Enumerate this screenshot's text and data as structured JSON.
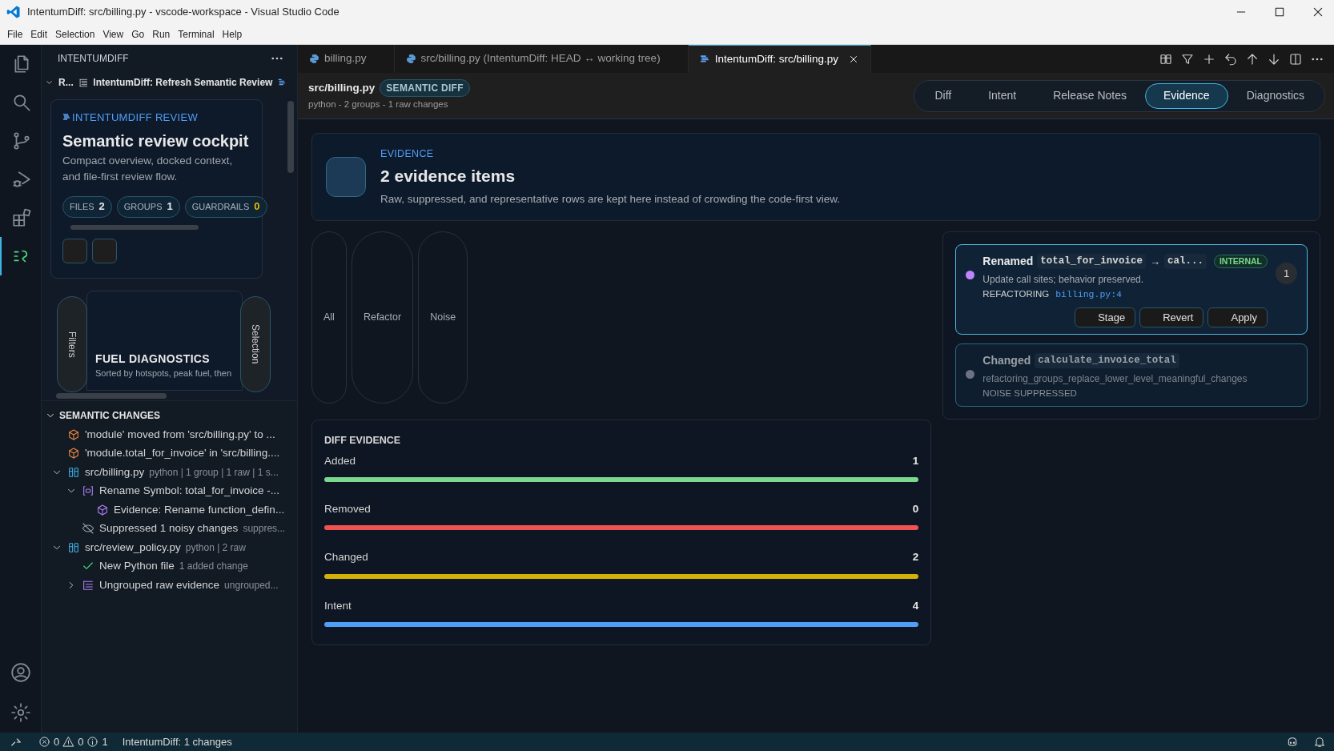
{
  "window": {
    "title": "IntentumDiff: src/billing.py - vscode-workspace - Visual Studio Code"
  },
  "menu": [
    "File",
    "Edit",
    "Selection",
    "View",
    "Go",
    "Run",
    "Terminal",
    "Help"
  ],
  "activity_bar": [
    {
      "kind": "files",
      "selected": false
    },
    {
      "kind": "search",
      "selected": false
    },
    {
      "kind": "source-control",
      "selected": false
    },
    {
      "kind": "run-debug",
      "selected": false
    },
    {
      "kind": "extensions",
      "selected": false
    },
    {
      "kind": "intentum",
      "selected": true
    }
  ],
  "sidebar": {
    "title": "INTENTUMDIFF",
    "section_header": {
      "collapsed_label": "R...",
      "command": "IntentumDiff: Refresh Semantic Review"
    },
    "review_card": {
      "eyebrow": "INTENTUMDIFF REVIEW",
      "heading": "Semantic review cockpit",
      "description": "Compact overview, docked context, and file-first review flow.",
      "stats": [
        {
          "label": "FILES",
          "value": "2",
          "kind": "normal"
        },
        {
          "label": "GROUPS",
          "value": "1",
          "kind": "normal"
        },
        {
          "label": "GUARDRAILS",
          "value": "0",
          "kind": "warning"
        }
      ]
    },
    "fuel_panel": {
      "left_tab": "Filters",
      "right_tab": "Selection",
      "heading": "FUEL DIAGNOSTICS",
      "subtitle": "Sorted by hotspots, peak fuel, then"
    },
    "semantic_changes": {
      "title": "SEMANTIC CHANGES",
      "expanded": true,
      "items": [
        {
          "kind": "cube-orange",
          "label": "'module' moved from 'src/billing.py' to ..."
        },
        {
          "kind": "cube-orange",
          "label": "'module.total_for_invoice' in 'src/billing...."
        },
        {
          "kind": "file",
          "label": "src/billing.py",
          "detail": "python | 1 group | 1 raw | 1 s...",
          "expanded": true,
          "children": [
            {
              "kind": "symbol",
              "label": "Rename Symbol: total_for_invoice -...",
              "expanded": true,
              "children": [
                {
                  "kind": "cube-purple",
                  "label": "Evidence: Rename function_defin..."
                }
              ]
            },
            {
              "kind": "eye-off",
              "label": "Suppressed 1 noisy changes",
              "detail": "suppres..."
            }
          ]
        },
        {
          "kind": "file",
          "label": "src/review_policy.py",
          "detail": "python | 2 raw",
          "expanded": true,
          "children": [
            {
              "kind": "check",
              "label": "New Python file",
              "detail": "1 added change"
            },
            {
              "kind": "list",
              "label": "Ungrouped raw evidence",
              "detail": "ungrouped...",
              "expanded": false
            }
          ]
        }
      ]
    }
  },
  "editor_tabs": [
    {
      "label": "billing.py",
      "kind": "python",
      "selected": false
    },
    {
      "label": "src/billing.py (IntentumDiff: HEAD ↔ working tree)",
      "kind": "python",
      "selected": false
    },
    {
      "label": "IntentumDiff: src/billing.py",
      "kind": "intentum",
      "selected": true
    }
  ],
  "header": {
    "file": "src/billing.py",
    "badge": "SEMANTIC DIFF",
    "meta": "python - 2 groups - 1 raw changes"
  },
  "view_tabs": [
    {
      "label": "Diff",
      "selected": false
    },
    {
      "label": "Intent",
      "selected": false
    },
    {
      "label": "Release Notes",
      "selected": false
    },
    {
      "label": "Evidence",
      "selected": true
    },
    {
      "label": "Diagnostics",
      "selected": false
    }
  ],
  "hero": {
    "eyebrow": "EVIDENCE",
    "heading": "2 evidence items",
    "description": "Raw, suppressed, and representative rows are kept here instead of crowding the code-first view."
  },
  "filters": [
    "All",
    "Refactor",
    "Noise"
  ],
  "evidence_items": [
    {
      "selected": true,
      "color": "#c084fc",
      "verb": "Renamed",
      "code_from": "total_for_invoice",
      "arrow": "→",
      "code_to": "cal...",
      "badge": "INTERNAL",
      "description": "Update call sites; behavior preserved.",
      "category": "REFACTORING",
      "location": "billing.py:4",
      "count": "1",
      "actions": [
        "Stage",
        "Revert",
        "Apply"
      ]
    },
    {
      "selected": false,
      "color": "#6b7280",
      "verb": "Changed",
      "code_from": "calculate_invoice_total",
      "description": "refactoring_groups_replace_lower_level_meaningful_changes",
      "category": "NOISE SUPPRESSED"
    }
  ],
  "diff_evidence": {
    "title": "DIFF EVIDENCE",
    "rows": [
      {
        "label": "Added",
        "value": "1",
        "level": 1,
        "color": "#7bd88f"
      },
      {
        "label": "Removed",
        "value": "0",
        "level": 1,
        "color": "#f05252"
      },
      {
        "label": "Changed",
        "value": "2",
        "level": 1,
        "color": "#d4b106"
      },
      {
        "label": "Intent",
        "value": "4",
        "level": 1,
        "color": "#4f9ef8"
      }
    ]
  },
  "status_bar": {
    "errors": "0",
    "warnings": "0",
    "infos": "1",
    "message": "IntentumDiff: 1 changes"
  }
}
